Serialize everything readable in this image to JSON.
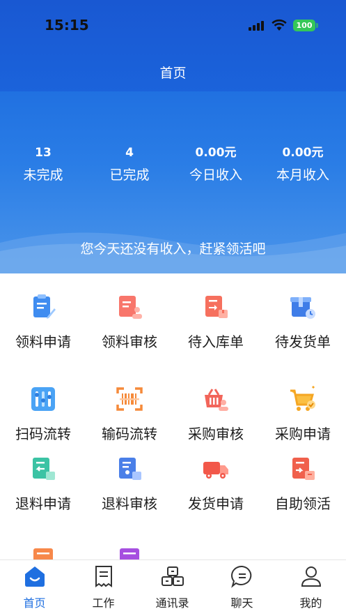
{
  "status_bar": {
    "time": "15:15",
    "battery": "100"
  },
  "header": {
    "title": "首页"
  },
  "stats": [
    {
      "value": "13",
      "label": "未完成"
    },
    {
      "value": "4",
      "label": "已完成"
    },
    {
      "value": "0.00元",
      "label": "今日收入"
    },
    {
      "value": "0.00元",
      "label": "本月收入"
    }
  ],
  "banner_text": "您今天还没有收入，赶紧领活吧",
  "grid": [
    {
      "label": "领料申请",
      "icon": "clipboard-pen-icon"
    },
    {
      "label": "领料审核",
      "icon": "clipboard-user-icon"
    },
    {
      "label": "待入库单",
      "icon": "warehouse-in-icon"
    },
    {
      "label": "待发货单",
      "icon": "box-clock-icon"
    },
    {
      "label": "扫码流转",
      "icon": "scan-grid-icon"
    },
    {
      "label": "输码流转",
      "icon": "barcode-icon"
    },
    {
      "label": "采购审核",
      "icon": "basket-user-icon"
    },
    {
      "label": "采购申请",
      "icon": "cart-check-icon"
    },
    {
      "label": "退料申请",
      "icon": "return-doc-icon"
    },
    {
      "label": "退料审核",
      "icon": "return-review-icon"
    },
    {
      "label": "发货申请",
      "icon": "truck-icon"
    },
    {
      "label": "自助领活",
      "icon": "self-service-icon"
    },
    {
      "label": "",
      "icon": "doc-orange-icon"
    },
    {
      "label": "",
      "icon": "doc-purple-icon"
    }
  ],
  "tabs": [
    {
      "label": "首页",
      "icon": "home-icon",
      "active": true
    },
    {
      "label": "工作",
      "icon": "receipt-icon",
      "active": false
    },
    {
      "label": "通讯录",
      "icon": "contacts-icon",
      "active": false
    },
    {
      "label": "聊天",
      "icon": "chat-icon",
      "active": false
    },
    {
      "label": "我的",
      "icon": "user-icon",
      "active": false
    }
  ],
  "colors": {
    "primary": "#1f6fe0",
    "header_dark": "#1958d2"
  }
}
